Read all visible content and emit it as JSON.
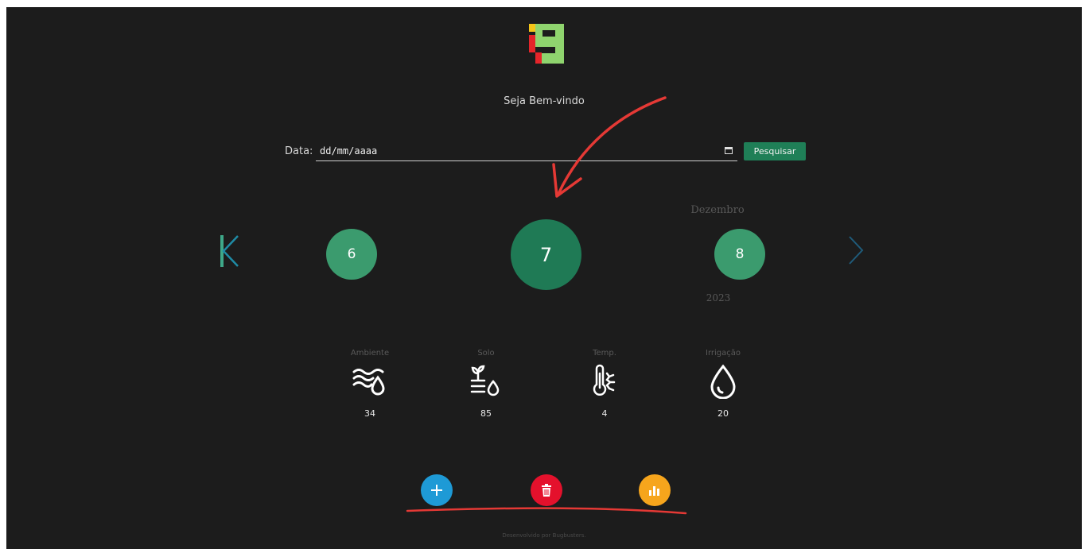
{
  "welcome_text": "Seja Bem-vindo",
  "search": {
    "label": "Data:",
    "date_value": "dd/mm/aaaa",
    "button_label": "Pesquisar",
    "calendar_icon": "calendar-icon"
  },
  "carousel": {
    "prev_day": "6",
    "current_day": "7",
    "next_day": "8",
    "month": "Dezembro",
    "year": "2023",
    "prev_icon": "chevron-left-icon",
    "next_icon": "chevron-right-icon"
  },
  "metrics": [
    {
      "label": "Ambiente",
      "value": "34",
      "icon": "wind-humidity-icon"
    },
    {
      "label": "Solo",
      "value": "85",
      "icon": "soil-moisture-icon"
    },
    {
      "label": "Temp.",
      "value": "4",
      "icon": "thermometer-icon"
    },
    {
      "label": "Irrigação",
      "value": "20",
      "icon": "water-drop-icon"
    }
  ],
  "actions": [
    {
      "icon": "plus-icon",
      "color": "#1e9ad6"
    },
    {
      "icon": "trash-icon",
      "color": "#e4112c"
    },
    {
      "icon": "bar-chart-icon",
      "color": "#f6a51c"
    }
  ],
  "footer": "Desenvolvido por Bugbusters.",
  "colors": {
    "background": "#1c1c1c",
    "accent_green": "#1f7a55",
    "day_green": "#3b9b6e",
    "logo_yellow": "#f5c518",
    "logo_red": "#e5252a",
    "logo_green": "#8fd46e",
    "annotation_red": "#e53935"
  }
}
